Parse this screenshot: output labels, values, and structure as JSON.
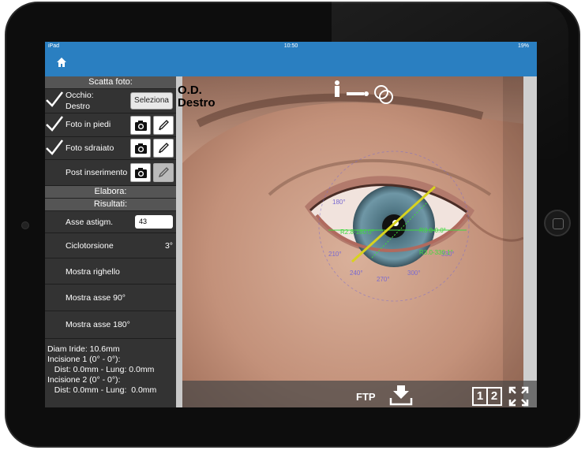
{
  "status": {
    "carrier": "iPad",
    "time": "10:50",
    "battery": "19%"
  },
  "nav": {
    "home_icon": "home-icon"
  },
  "sidebar": {
    "header_photo": "Scatta foto:",
    "eye_label": "Occhio:",
    "eye_value": "Destro",
    "select_button": "Seleziona",
    "photo_standing": "Foto in piedi",
    "photo_lying": "Foto sdraiato",
    "post_insertion": "Post inserimento",
    "header_process": "Elabora:",
    "header_results": "Risultati:",
    "astig_axis_label": "Asse astigm.",
    "astig_axis_value": "43",
    "cyclotorsion_label": "Ciclotorsione",
    "cyclotorsion_value": "3°",
    "show_ruler": "Mostra righello",
    "show_axis_90": "Mostra asse 90°",
    "show_axis_180": "Mostra asse 180°",
    "info_lines": "Diam Iride: 10.6mm\nIncisione 1 (0° - 0°):\n   Dist: 0.0mm - Lung: 0.0mm\nIncisione 2 (0° - 0°):\n   Dist: 0.0mm - Lung:  0.0mm"
  },
  "overlay": {
    "eye_code": "O.D.",
    "eye_name": "Destro",
    "ftp_label": "FTP",
    "view_toggle_1": "1",
    "view_toggle_2": "2",
    "angle_labels": [
      "180°",
      "210°",
      "240°",
      "270°",
      "300°",
      "330°"
    ],
    "left_readout": "R2.8-180.0°",
    "right_readout": "R3.0-0.0°",
    "lower_readout": "R3.0-330.1°"
  },
  "colors": {
    "accent": "#2a7fc1",
    "overlay_green": "#3fd83f",
    "overlay_yellow": "#d8d21e",
    "overlay_purple": "#7a6ad0"
  }
}
